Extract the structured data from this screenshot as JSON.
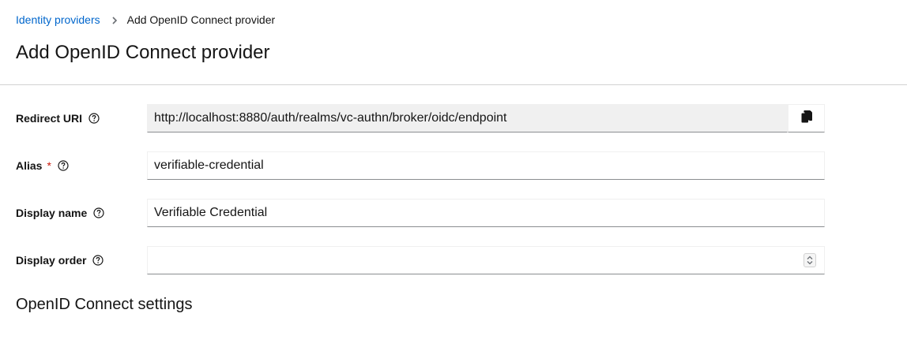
{
  "breadcrumb": {
    "parent_label": "Identity providers",
    "current_label": "Add OpenID Connect provider"
  },
  "page_title": "Add OpenID Connect provider",
  "form": {
    "redirect_uri": {
      "label": "Redirect URI",
      "value": "http://localhost:8880/auth/realms/vc-authn/broker/oidc/endpoint"
    },
    "alias": {
      "label": "Alias",
      "required_marker": "*",
      "value": "verifiable-credential"
    },
    "display_name": {
      "label": "Display name",
      "value": "Verifiable Credential"
    },
    "display_order": {
      "label": "Display order",
      "value": ""
    }
  },
  "section_title": "OpenID Connect settings",
  "icons": {
    "help": "help-circle-icon",
    "copy": "copy-icon",
    "breadcrumb_separator": "chevron-right-icon",
    "stepper": "up-down-arrows-icon"
  },
  "colors": {
    "link": "#0066cc",
    "required": "#c9190b",
    "readonly_bg": "#f0f0f0"
  }
}
